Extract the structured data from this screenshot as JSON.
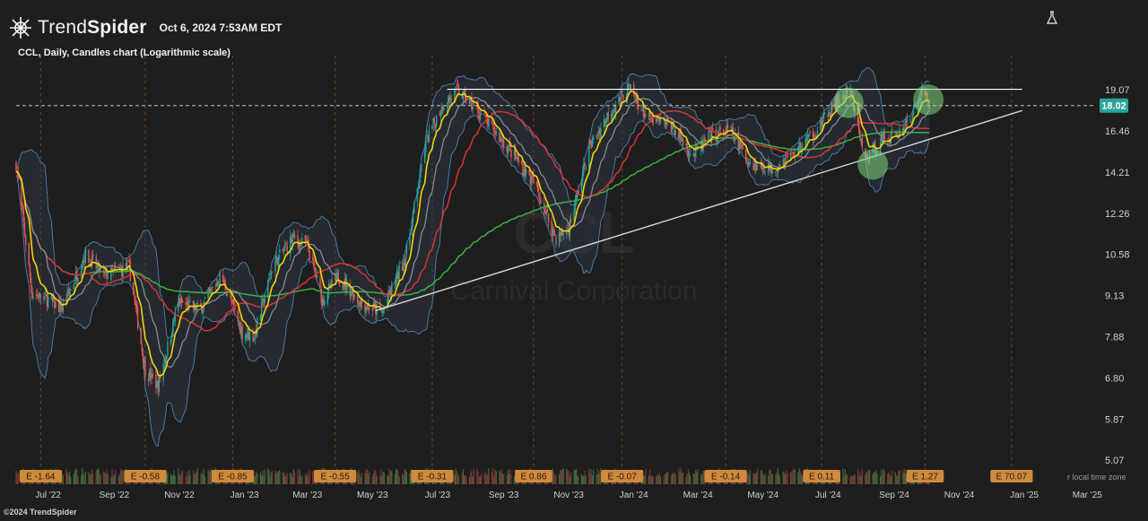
{
  "header": {
    "brand_light": "Trend",
    "brand_bold": "Spider",
    "timestamp": "Oct 6, 2024 7:53AM EDT",
    "subtitle": "CCL, Daily, Candles chart (Logarithmic scale)",
    "copyright": "©2024 TrendSpider",
    "logo_icon": "spider-web-icon",
    "settings_icon": "settings-flask-icon"
  },
  "chart_data": {
    "type": "candlestick",
    "symbol": "CCL",
    "watermark_ticker": "CCL",
    "watermark_name": "Carnival Corporation",
    "scale": "log",
    "ylim": [
      4.65,
      21.0
    ],
    "y_ticks": [
      19.07,
      16.46,
      14.21,
      12.26,
      10.58,
      9.13,
      7.88,
      6.8,
      5.87,
      5.07
    ],
    "last_price": 18.02,
    "x_ticks": [
      "Jul '22",
      "Sep '22",
      "Nov '22",
      "Jan '23",
      "Mar '23",
      "May '23",
      "Jul '23",
      "Sep '23",
      "Nov '23",
      "Jan '24",
      "Mar '24",
      "May '24",
      "Jul '24",
      "Sep '24",
      "Nov '24",
      "Jan '25",
      "Mar '25"
    ],
    "price_path": [
      [
        "2022-06-01",
        14.6
      ],
      [
        "2022-06-16",
        9.2
      ],
      [
        "2022-07-01",
        9.0
      ],
      [
        "2022-07-14",
        8.7
      ],
      [
        "2022-08-05",
        10.6
      ],
      [
        "2022-08-22",
        9.8
      ],
      [
        "2022-09-15",
        10.1
      ],
      [
        "2022-09-30",
        7.0
      ],
      [
        "2022-10-12",
        6.6
      ],
      [
        "2022-10-31",
        8.9
      ],
      [
        "2022-11-20",
        8.7
      ],
      [
        "2022-12-10",
        9.8
      ],
      [
        "2022-12-30",
        8.0
      ],
      [
        "2023-01-10",
        7.9
      ],
      [
        "2023-01-28",
        10.2
      ],
      [
        "2023-02-15",
        11.2
      ],
      [
        "2023-03-01",
        10.9
      ],
      [
        "2023-03-15",
        9.0
      ],
      [
        "2023-03-30",
        9.8
      ],
      [
        "2023-04-20",
        8.9
      ],
      [
        "2023-05-10",
        8.6
      ],
      [
        "2023-06-01",
        10.5
      ],
      [
        "2023-06-20",
        15.8
      ],
      [
        "2023-07-05",
        18.0
      ],
      [
        "2023-07-20",
        19.0
      ],
      [
        "2023-08-10",
        17.5
      ],
      [
        "2023-09-05",
        15.5
      ],
      [
        "2023-09-30",
        13.6
      ],
      [
        "2023-10-20",
        11.2
      ],
      [
        "2023-11-01",
        11.6
      ],
      [
        "2023-11-20",
        15.5
      ],
      [
        "2023-12-10",
        17.7
      ],
      [
        "2023-12-27",
        19.2
      ],
      [
        "2024-01-15",
        17.1
      ],
      [
        "2024-02-05",
        16.8
      ],
      [
        "2024-02-25",
        15.1
      ],
      [
        "2024-03-15",
        16.2
      ],
      [
        "2024-03-30",
        16.5
      ],
      [
        "2024-04-20",
        14.6
      ],
      [
        "2024-05-10",
        14.4
      ],
      [
        "2024-06-01",
        15.3
      ],
      [
        "2024-06-20",
        16.5
      ],
      [
        "2024-07-10",
        18.3
      ],
      [
        "2024-07-22",
        18.9
      ],
      [
        "2024-08-05",
        14.8
      ],
      [
        "2024-08-20",
        16.0
      ],
      [
        "2024-09-05",
        16.3
      ],
      [
        "2024-09-20",
        17.6
      ],
      [
        "2024-09-27",
        19.0
      ],
      [
        "2024-10-04",
        18.02
      ]
    ],
    "resistance_line": {
      "price": 19.1,
      "from": "2023-07-10",
      "to": "2024-12-30"
    },
    "support_trendline": {
      "from": [
        "2023-05-04",
        8.65
      ],
      "to": [
        "2024-12-30",
        17.7
      ]
    },
    "highlights": [
      {
        "date": "2024-07-20",
        "price": 18.2
      },
      {
        "date": "2024-08-12",
        "price": 14.6
      },
      {
        "date": "2024-10-03",
        "price": 18.4
      }
    ],
    "earnings": [
      {
        "label": "E -1.64",
        "date": "2022-06-24"
      },
      {
        "label": "E -0.58",
        "date": "2022-09-30"
      },
      {
        "label": "E -0.85",
        "date": "2022-12-21"
      },
      {
        "label": "E -0.55",
        "date": "2023-03-27"
      },
      {
        "label": "E -0.31",
        "date": "2023-06-26"
      },
      {
        "label": "E 0.86",
        "date": "2023-09-29"
      },
      {
        "label": "E -0.07",
        "date": "2023-12-21"
      },
      {
        "label": "E -0.14",
        "date": "2024-03-27"
      },
      {
        "label": "E 0.11",
        "date": "2024-06-25"
      },
      {
        "label": "E 1.27",
        "date": "2024-09-30"
      },
      {
        "label": "E 70.07",
        "date": "2024-12-20"
      }
    ],
    "timezone_note": "r local time zone",
    "colors": {
      "background": "#1e1e1e",
      "grid": "#2f2f2f",
      "up": "#26a69a",
      "down": "#ef5350",
      "ema_fast": "#f5d20b",
      "ma_mid": "#d43333",
      "ma_slow": "#3cb043",
      "ma_gray": "#8a8a8a",
      "bollinger": "#4f7fae",
      "last_price_tag": "#26a69a",
      "earnings_tag": "#cf8a3c"
    }
  }
}
